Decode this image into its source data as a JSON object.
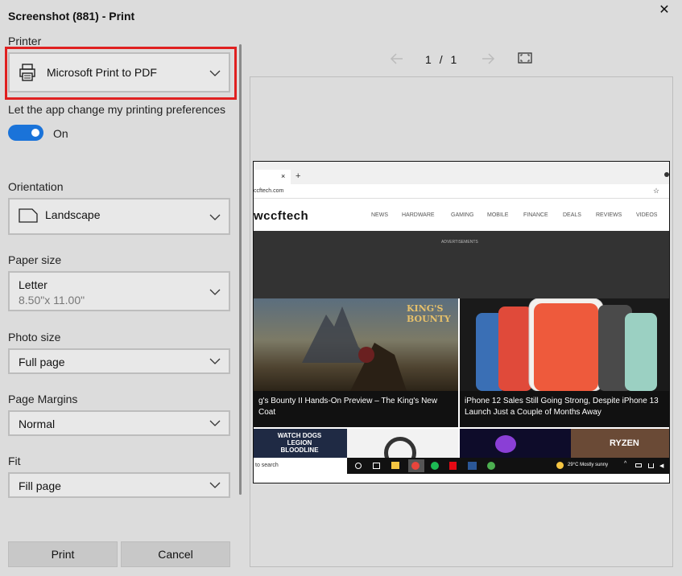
{
  "window": {
    "title": "Screenshot (881) - Print",
    "close_glyph": "✕"
  },
  "printer": {
    "label": "Printer",
    "value": "Microsoft Print to PDF",
    "icon": "printer-icon"
  },
  "preferences": {
    "label": "Let the app change my printing preferences",
    "toggle_state": "On",
    "toggle_on": true
  },
  "orientation": {
    "label": "Orientation",
    "value": "Landscape",
    "icon": "page-landscape-icon"
  },
  "paper_size": {
    "label": "Paper size",
    "value": "Letter",
    "detail": "8.50\"x 11.00\""
  },
  "photo_size": {
    "label": "Photo size",
    "value": "Full page"
  },
  "page_margins": {
    "label": "Page Margins",
    "value": "Normal"
  },
  "fit": {
    "label": "Fit",
    "value": "Fill page"
  },
  "actions": {
    "print_label": "Print",
    "cancel_label": "Cancel"
  },
  "preview_nav": {
    "current_page": "1",
    "separator": "/",
    "total_pages": "1"
  },
  "preview_page": {
    "tab_close": "×",
    "tab_add": "+",
    "address": "ccftech.com",
    "site_logo": "wccftech",
    "nav_items": [
      "NEWS",
      "HARDWARE",
      "GAMING",
      "MOBILE",
      "FINANCE",
      "DEALS",
      "REVIEWS",
      "VIDEOS"
    ],
    "ad_label": "ADVERTISEMENTS",
    "story_left": "g's Bounty II Hands-On Preview – The King's New Coat",
    "story_left_art": "KING'S BOUNTY",
    "story_right": "iPhone 12 Sales Still Going Strong, Despite iPhone 13 Launch Just a Couple of Months Away",
    "thumb_1": "WATCH DOGS LEGION BLOODLINE",
    "thumb_4": "RYZEN",
    "taskbar_search": "to search",
    "weather": "29°C  Mostly sunny"
  },
  "colors": {
    "accent": "#1a73d9",
    "highlight": "#e02020",
    "background": "#dcdcdc"
  }
}
